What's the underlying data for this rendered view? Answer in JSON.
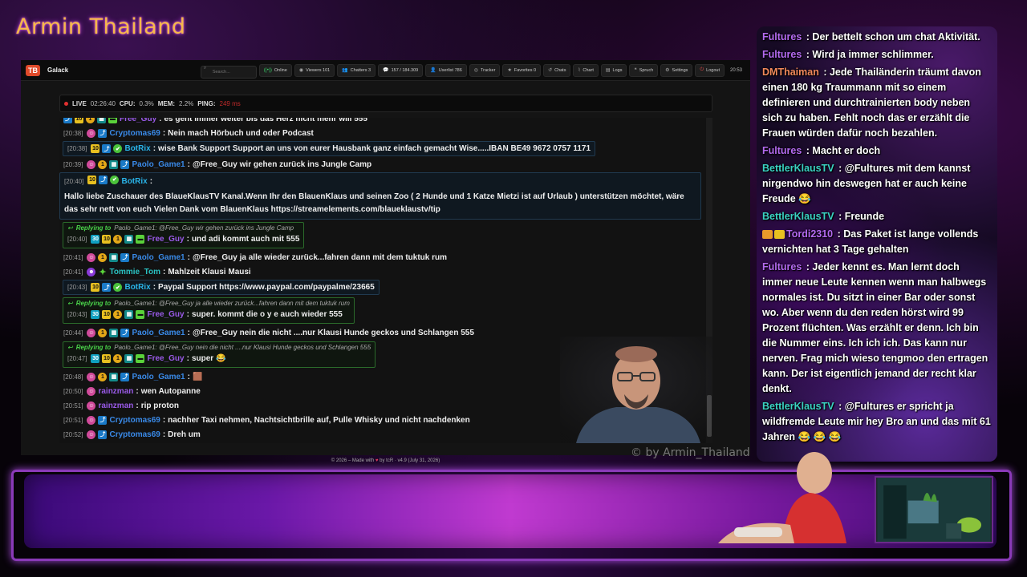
{
  "overlay": {
    "stream_title": "Armin Thailand",
    "watermark": "© by Armin_Thailand"
  },
  "app": {
    "logo": "TB",
    "name": "Galack",
    "search_placeholder": "Search...",
    "toolbar": [
      {
        "id": "online",
        "icon": "signal-icon",
        "glyph": "((•))",
        "label": "Online"
      },
      {
        "id": "viewers",
        "icon": "eye-icon",
        "glyph": "◉",
        "label": "Viewers 101"
      },
      {
        "id": "chatters",
        "icon": "users-icon",
        "glyph": "👥",
        "label": "Chatters 3"
      },
      {
        "id": "messages",
        "icon": "chat-bubble-icon",
        "glyph": "💬",
        "label": "157 / 184.309"
      },
      {
        "id": "userlist",
        "icon": "user-icon",
        "glyph": "👤",
        "label": "Userlist 786"
      },
      {
        "id": "tracker",
        "icon": "crosshair-icon",
        "glyph": "◎",
        "label": "Tracker"
      },
      {
        "id": "favorites",
        "icon": "star-icon",
        "glyph": "★",
        "label": "Favorites 0"
      },
      {
        "id": "chats",
        "icon": "history-icon",
        "glyph": "↺",
        "label": "Chats"
      },
      {
        "id": "chart",
        "icon": "chart-line-icon",
        "glyph": "⌇",
        "label": "Chart"
      },
      {
        "id": "logs",
        "icon": "logs-icon",
        "glyph": "▤",
        "label": "Logs"
      },
      {
        "id": "spruch",
        "icon": "quote-icon",
        "glyph": "❝",
        "label": "Spruch"
      },
      {
        "id": "settings",
        "icon": "gear-icon",
        "glyph": "⚙",
        "label": "Settings"
      },
      {
        "id": "logout",
        "icon": "logout-icon",
        "glyph": "⏻",
        "label": "Logout"
      }
    ],
    "clock": "20:53",
    "status": {
      "live_label": "LIVE",
      "uptime": "02:26:40",
      "cpu_label": "CPU:",
      "cpu_value": "0.3%",
      "mem_label": "MEM:",
      "mem_value": "2.2%",
      "ping_label": "PING:",
      "ping_value": "249 ms"
    },
    "footer": {
      "prefix": "© 2026 – Made with",
      "suffix": "by tcR · v4.9 (July 31, 2026)"
    },
    "messages": [
      {
        "type": "msg",
        "time": "",
        "badges": [
          "b-blue",
          "b-sub",
          "b-gold",
          "b-teal",
          "b-lime"
        ],
        "user": "Free_Guy",
        "ucls": "u-purple",
        "text": "es geht immer weiter bis das Herz nicht mehr will 555"
      },
      {
        "type": "msg",
        "time": "[20:38]",
        "badges": [
          "b-pink",
          "b-blue"
        ],
        "user": "Cryptomas69",
        "ucls": "u-blue",
        "text": "Nein mach Hörbuch und oder Podcast"
      },
      {
        "type": "bot",
        "time": "[20:38]",
        "badges": [
          "b-sub",
          "b-blue",
          "b-green"
        ],
        "user": "BotRix",
        "ucls": "u-cyan",
        "text": "wise Bank Support Support an uns von eurer Hausbank ganz einfach gemacht Wise.....IBAN BE49 9672 0757 1171"
      },
      {
        "type": "msg",
        "time": "[20:39]",
        "badges": [
          "b-pink",
          "b-gold",
          "b-teal",
          "b-blue"
        ],
        "user": "Paolo_Game1",
        "ucls": "u-blue",
        "text": "@Free_Guy wir gehen zurück ins Jungle Camp"
      },
      {
        "type": "botmulti",
        "time": "[20:40]",
        "badges": [
          "b-sub",
          "b-blue",
          "b-green"
        ],
        "user": "BotRix",
        "ucls": "u-cyan",
        "text": "Hallo liebe Zuschauer des BlaueKlausTV Kanal.Wenn Ihr den BlauenKlaus und seinen Zoo ( 2 Hunde und 1 Katze Mietzi ist auf Urlaub ) unterstützen möchtet, wäre das sehr nett von euch Vielen Dank vom BlauenKlaus https://streamelements.com/blaueklaustv/tip"
      },
      {
        "type": "reply",
        "reply_label": "Replying to",
        "reply_text": "Paolo_Game1: @Free_Guy wir gehen zurück ins Jungle Camp",
        "time": "[20:40]",
        "badges": [
          "b-cyan",
          "b-sub",
          "b-gold",
          "b-teal",
          "b-lime"
        ],
        "user": "Free_Guy",
        "ucls": "u-purple",
        "text": "und adi kommt auch mit 555"
      },
      {
        "type": "msg",
        "time": "[20:41]",
        "badges": [
          "b-pink",
          "b-gold",
          "b-teal",
          "b-blue"
        ],
        "user": "Paolo_Game1",
        "ucls": "u-blue",
        "text": "@Free_Guy ja alle wieder zurück...fahren dann mit dem tuktuk rum"
      },
      {
        "type": "msg",
        "time": "[20:41]",
        "badges": [
          "b-purple",
          "b-star"
        ],
        "user": "Tommie_Tom",
        "ucls": "u-teal",
        "text": "Mahlzeit Klausi Mausi"
      },
      {
        "type": "bot",
        "time": "[20:43]",
        "badges": [
          "b-sub",
          "b-blue",
          "b-green"
        ],
        "user": "BotRix",
        "ucls": "u-cyan",
        "text": "Paypal Support https://www.paypal.com/paypalme/23665"
      },
      {
        "type": "reply",
        "reply_label": "Replying to",
        "reply_text": "Paolo_Game1: @Free_Guy ja alle wieder zurück...fahren dann mit dem tuktuk rum",
        "time": "[20:43]",
        "badges": [
          "b-cyan",
          "b-sub",
          "b-gold",
          "b-teal",
          "b-lime"
        ],
        "user": "Free_Guy",
        "ucls": "u-purple",
        "text": "super. kommt die o y e auch wieder 555"
      },
      {
        "type": "msg",
        "time": "[20:44]",
        "badges": [
          "b-pink",
          "b-gold",
          "b-teal",
          "b-blue"
        ],
        "user": "Paolo_Game1",
        "ucls": "u-blue",
        "text": "@Free_Guy nein die nicht ....nur Klausi Hunde geckos und Schlangen 555"
      },
      {
        "type": "reply",
        "reply_label": "Replying to",
        "reply_text": "Paolo_Game1: @Free_Guy nein die nicht ....nur Klausi Hunde geckos und Schlangen 555",
        "time": "[20:47]",
        "badges": [
          "b-cyan",
          "b-sub",
          "b-gold",
          "b-teal",
          "b-lime"
        ],
        "user": "Free_Guy",
        "ucls": "u-purple",
        "text": "super 😂"
      },
      {
        "type": "msg",
        "time": "[20:48]",
        "badges": [
          "b-pink",
          "b-gold",
          "b-teal",
          "b-blue"
        ],
        "user": "Paolo_Game1",
        "ucls": "u-blue",
        "text": "🟫"
      },
      {
        "type": "msg",
        "time": "[20:50]",
        "badges": [
          "b-pink"
        ],
        "user": "rainzman",
        "ucls": "u-purple",
        "text": "wen Autopanne"
      },
      {
        "type": "msg",
        "time": "[20:51]",
        "badges": [
          "b-pink"
        ],
        "user": "rainzman",
        "ucls": "u-purple",
        "text": "rip proton"
      },
      {
        "type": "msg",
        "time": "[20:51]",
        "badges": [
          "b-pink",
          "b-blue"
        ],
        "user": "Cryptomas69",
        "ucls": "u-blue",
        "text": "nachher Taxi nehmen, Nachtsichtbrille auf, Pulle Whisky und nicht nachdenken"
      },
      {
        "type": "msg",
        "time": "[20:52]",
        "badges": [
          "b-pink",
          "b-blue"
        ],
        "user": "Cryptomas69",
        "ucls": "u-blue",
        "text": "Dreh um"
      }
    ]
  },
  "side_chat": [
    {
      "user": "Fultures",
      "ucls": "sc-purple",
      "text": "Der bettelt schon um chat Aktivität."
    },
    {
      "user": "Fultures",
      "ucls": "sc-purple",
      "text": "Wird ja immer schlimmer."
    },
    {
      "user": "DMThaiman",
      "ucls": "sc-orange",
      "text": "Jede Thailänderin träumt davon einen 180 kg Traummann mit so einem definieren und durchtrainierten body neben sich zu haben. Fehlt noch das er erzählt die Frauen würden dafür noch bezahlen."
    },
    {
      "user": "Fultures",
      "ucls": "sc-purple",
      "text": "Macht er doch"
    },
    {
      "user": "BettlerKlausTV",
      "ucls": "sc-teal",
      "text": "@Fultures mit dem kannst nirgendwo hin deswegen hat er auch keine Freude 😂"
    },
    {
      "user": "BettlerKlausTV",
      "ucls": "sc-teal",
      "text": "Freunde"
    },
    {
      "user": "Tordi2310",
      "ucls": "sc-purple",
      "badges": true,
      "text": "Das Paket ist lange vollends vernichten hat 3 Tage gehalten"
    },
    {
      "user": "Fultures",
      "ucls": "sc-purple",
      "text": "Jeder kennt es. Man lernt doch immer neue Leute kennen wenn man halbwegs normales ist. Du sitzt in einer Bar oder sonst wo. Aber wenn du den reden hörst wird 99 Prozent flüchten. Was erzählt er denn. Ich bin die Nummer eins. Ich ich ich. Das kann nur nerven. Frag mich wieso tengmoo den ertragen kann. Der ist eigentlich jemand der recht klar denkt."
    },
    {
      "user": "BettlerKlausTV",
      "ucls": "sc-teal",
      "text": "@Fultures er spricht ja wildfremde Leute mir hey Bro an und das mit 61 Jahren 😂 😂 😂"
    }
  ]
}
